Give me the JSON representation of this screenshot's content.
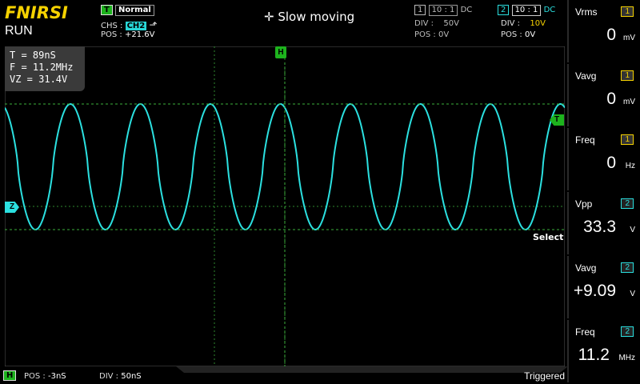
{
  "header": {
    "brand": "FNIRSI",
    "run_state": "RUN",
    "trigger": {
      "badge": "T",
      "mode": "Normal",
      "source_label": "CHS :",
      "source": "CH2",
      "edge_icon": "rising-edge",
      "pos_label": "POS :",
      "pos": "+21.6V"
    },
    "mode_label": "Slow moving",
    "ch1": {
      "num": "1",
      "probe": "10 : 1",
      "coupling": "DC",
      "div_label": "DIV :",
      "div": "50V",
      "pos_label": "POS :",
      "pos": "0V"
    },
    "ch2": {
      "num": "2",
      "probe": "10 : 1",
      "coupling": "DC",
      "div_label": "DIV :",
      "div": "10V",
      "pos_label": "POS :",
      "pos": "0V"
    }
  },
  "cursor_measure": {
    "t": "T = 89nS",
    "f": "F = 11.2MHz",
    "vz": "VZ = 31.4V"
  },
  "markers": {
    "h": "H",
    "t": "T",
    "z": "Z",
    "select": "Select"
  },
  "right_panel": [
    {
      "label": "Vrms",
      "ch": "1",
      "value": "0",
      "unit": "mV"
    },
    {
      "label": "Vavg",
      "ch": "1",
      "value": "0",
      "unit": "mV"
    },
    {
      "label": "Freq",
      "ch": "1",
      "value": "0",
      "unit": "Hz"
    },
    {
      "label": "Vpp",
      "ch": "2",
      "value": "33.3",
      "unit": "V"
    },
    {
      "label": "Vavg",
      "ch": "2",
      "value": "+9.09",
      "unit": "V"
    },
    {
      "label": "Freq",
      "ch": "2",
      "value": "11.2",
      "unit": "MHz"
    }
  ],
  "footer": {
    "h_badge": "H",
    "pos_label": "POS :",
    "pos": "-3nS",
    "div_label": "DIV :",
    "div": "50nS",
    "status": "Triggered"
  },
  "colors": {
    "trace": "#2be0e0",
    "trigger_green": "#1db31d",
    "brand": "#f6d200",
    "grid": "#2f8a2f"
  },
  "waveform": {
    "periods_visible": 7.8,
    "cycles_per_div": 1,
    "shape": "sine-like clipped"
  }
}
